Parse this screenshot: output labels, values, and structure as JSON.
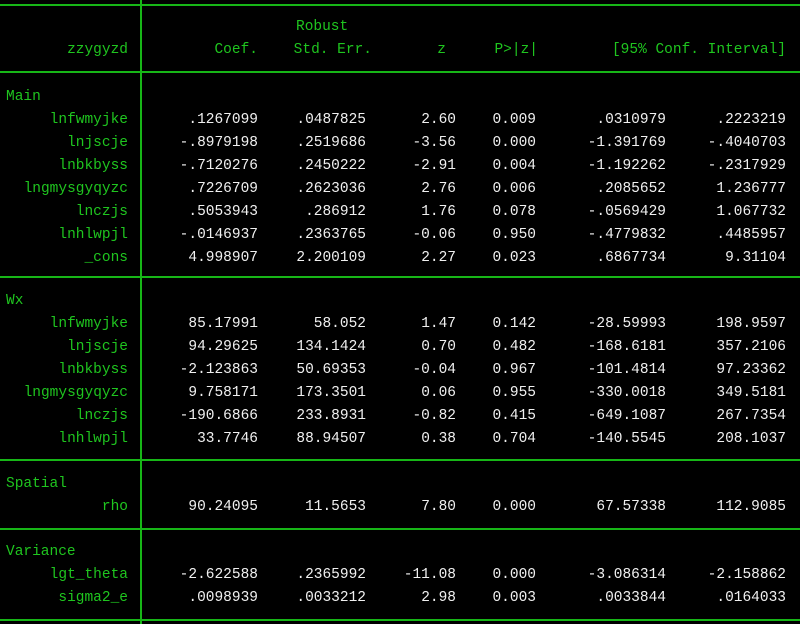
{
  "header": {
    "depvar": "zzygyzd",
    "robust": "Robust",
    "coef": "Coef.",
    "se": "Std. Err.",
    "z": "z",
    "p": "P>|z|",
    "ci": "[95% Conf. Interval]"
  },
  "sections": [
    {
      "title": "Main",
      "rows": [
        {
          "name": "lnfwmyjke",
          "coef": ".1267099",
          "se": ".0487825",
          "z": "2.60",
          "p": "0.009",
          "lo": ".0310979",
          "hi": ".2223219"
        },
        {
          "name": "lnjscje",
          "coef": "-.8979198",
          "se": ".2519686",
          "z": "-3.56",
          "p": "0.000",
          "lo": "-1.391769",
          "hi": "-.4040703"
        },
        {
          "name": "lnbkbyss",
          "coef": "-.7120276",
          "se": ".2450222",
          "z": "-2.91",
          "p": "0.004",
          "lo": "-1.192262",
          "hi": "-.2317929"
        },
        {
          "name": "lngmysgyqyzc",
          "coef": ".7226709",
          "se": ".2623036",
          "z": "2.76",
          "p": "0.006",
          "lo": ".2085652",
          "hi": "1.236777"
        },
        {
          "name": "lnczjs",
          "coef": ".5053943",
          "se": ".286912",
          "z": "1.76",
          "p": "0.078",
          "lo": "-.0569429",
          "hi": "1.067732"
        },
        {
          "name": "lnhlwpjl",
          "coef": "-.0146937",
          "se": ".2363765",
          "z": "-0.06",
          "p": "0.950",
          "lo": "-.4779832",
          "hi": ".4485957"
        },
        {
          "name": "_cons",
          "coef": "4.998907",
          "se": "2.200109",
          "z": "2.27",
          "p": "0.023",
          "lo": ".6867734",
          "hi": "9.31104"
        }
      ]
    },
    {
      "title": "Wx",
      "rows": [
        {
          "name": "lnfwmyjke",
          "coef": "85.17991",
          "se": "58.052",
          "z": "1.47",
          "p": "0.142",
          "lo": "-28.59993",
          "hi": "198.9597"
        },
        {
          "name": "lnjscje",
          "coef": "94.29625",
          "se": "134.1424",
          "z": "0.70",
          "p": "0.482",
          "lo": "-168.6181",
          "hi": "357.2106"
        },
        {
          "name": "lnbkbyss",
          "coef": "-2.123863",
          "se": "50.69353",
          "z": "-0.04",
          "p": "0.967",
          "lo": "-101.4814",
          "hi": "97.23362"
        },
        {
          "name": "lngmysgyqyzc",
          "coef": "9.758171",
          "se": "173.3501",
          "z": "0.06",
          "p": "0.955",
          "lo": "-330.0018",
          "hi": "349.5181"
        },
        {
          "name": "lnczjs",
          "coef": "-190.6866",
          "se": "233.8931",
          "z": "-0.82",
          "p": "0.415",
          "lo": "-649.1087",
          "hi": "267.7354"
        },
        {
          "name": "lnhlwpjl",
          "coef": "33.7746",
          "se": "88.94507",
          "z": "0.38",
          "p": "0.704",
          "lo": "-140.5545",
          "hi": "208.1037"
        }
      ]
    },
    {
      "title": "Spatial",
      "rows": [
        {
          "name": "rho",
          "coef": "90.24095",
          "se": "11.5653",
          "z": "7.80",
          "p": "0.000",
          "lo": "67.57338",
          "hi": "112.9085"
        }
      ]
    },
    {
      "title": "Variance",
      "rows": [
        {
          "name": "lgt_theta",
          "coef": "-2.622588",
          "se": ".2365992",
          "z": "-11.08",
          "p": "0.000",
          "lo": "-3.086314",
          "hi": "-2.158862"
        },
        {
          "name": "sigma2_e",
          "coef": ".0098939",
          "se": ".0033212",
          "z": "2.98",
          "p": "0.003",
          "lo": ".0033844",
          "hi": ".0164033"
        }
      ]
    }
  ]
}
